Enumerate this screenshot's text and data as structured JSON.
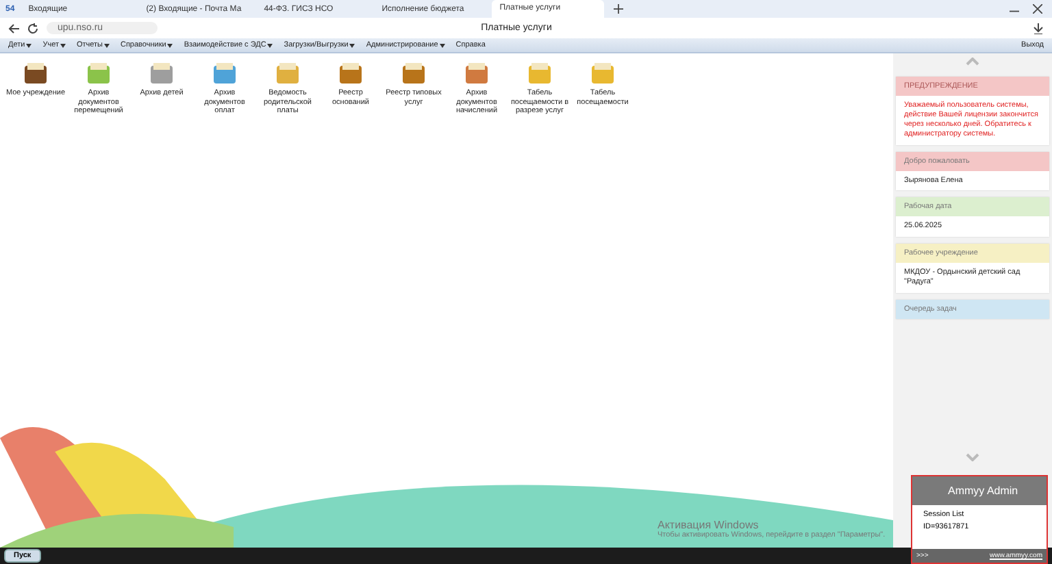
{
  "browser": {
    "pinned_label": "54",
    "tabs": [
      {
        "title": "Входящие",
        "selected": false
      },
      {
        "title": "(2) Входящие - Почта Ма",
        "selected": false
      },
      {
        "title": "44-ФЗ. ГИСЗ НСО",
        "selected": false
      },
      {
        "title": "Исполнение бюджета",
        "selected": false
      },
      {
        "title": "Платные услуги",
        "selected": true
      }
    ],
    "address": "upu.nso.ru",
    "page_title": "Платные услуги"
  },
  "menu": {
    "items": [
      {
        "label": "Дети",
        "dropdown": true
      },
      {
        "label": "Учет",
        "dropdown": true
      },
      {
        "label": "Отчеты",
        "dropdown": true
      },
      {
        "label": "Справочники",
        "dropdown": true
      },
      {
        "label": "Взаимодействие с ЭДС",
        "dropdown": true
      },
      {
        "label": "Загрузки/Выгрузки",
        "dropdown": true
      },
      {
        "label": "Администрирование",
        "dropdown": true
      },
      {
        "label": "Справка",
        "dropdown": false
      }
    ],
    "logout": "Выход"
  },
  "tiles": [
    "Мое учреждение",
    "Архив документов перемещений",
    "Архив детей",
    "Архив документов оплат",
    "Ведомость родительской платы",
    "Реестр оснований",
    "Реестр типовых услуг",
    "Архив документов начислений",
    "Табель посещаемости в разрезе услуг",
    "Табель посещаемости"
  ],
  "sidebar": {
    "panels": [
      {
        "title": "ПРЕДУПРЕЖДЕНИЕ",
        "color": "#f4c6c6",
        "body": "Уважаемый пользователь системы, действие Вашей лицензии закончится через несколько дней. Обратитесь к администратору системы.",
        "alert": true
      },
      {
        "title": "Добро пожаловать",
        "color": "#f4c6c6",
        "body": "Зырянова Елена",
        "alert": false
      },
      {
        "title": "Рабочая дата",
        "color": "#dcefcf",
        "body": "25.06.2025",
        "alert": false
      },
      {
        "title": "Рабочее учреждение",
        "color": "#f6f0c4",
        "body": "МКДОУ - Ордынский детский сад \"Радуга\"",
        "alert": false
      },
      {
        "title": "Очередь задач",
        "color": "#cfe6f3",
        "alert": false
      }
    ]
  },
  "ammyy": {
    "title": "Ammyy Admin",
    "session_label": "Session List",
    "id": "ID=93617871",
    "more": ">>>",
    "link": "www.ammyy.com"
  },
  "windows_activation": {
    "title": "Активация Windows",
    "text": "Чтобы активировать Windows, перейдите в раздел \"Параметры\"."
  },
  "taskbar": {
    "start": "Пуск"
  }
}
